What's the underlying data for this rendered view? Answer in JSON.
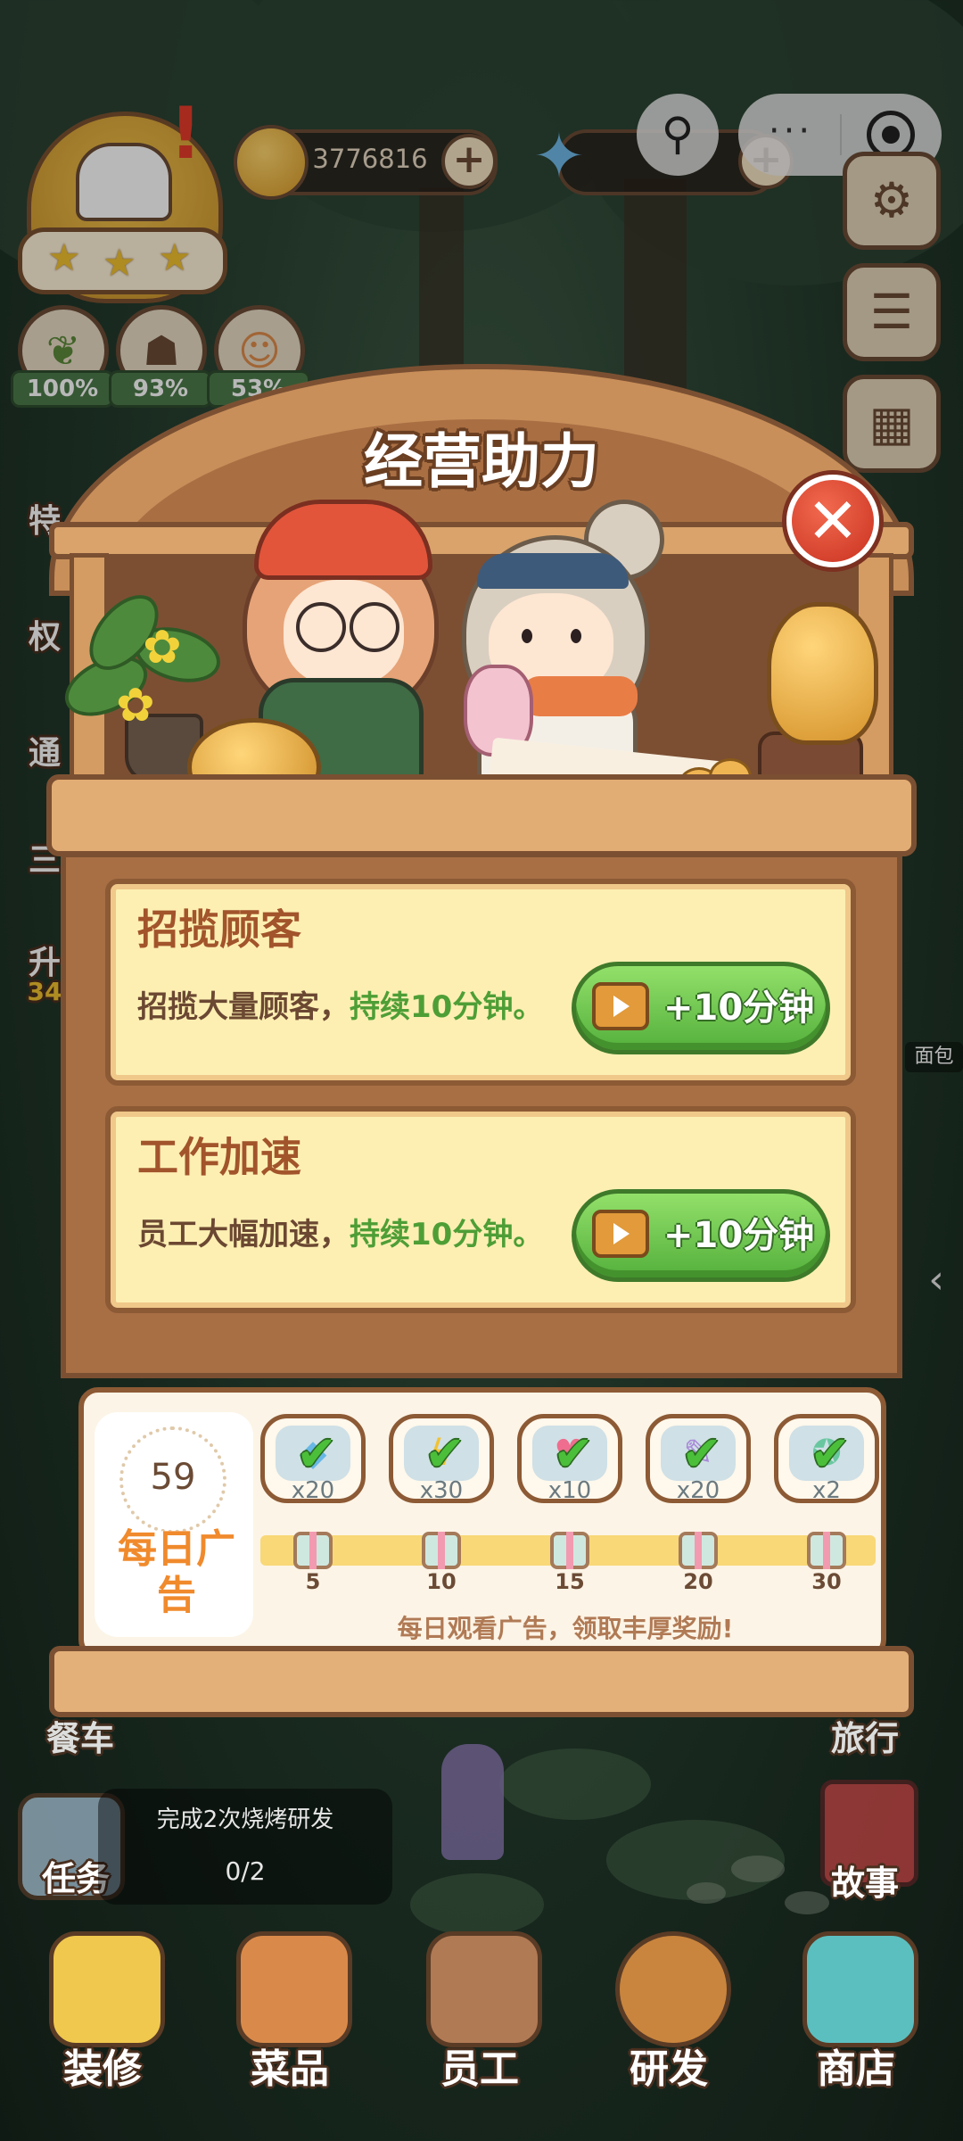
{
  "hud": {
    "coins": "3776816",
    "stats": [
      "100%",
      "93%",
      "53%"
    ],
    "plus": "+"
  },
  "mini_program": {
    "more": "···"
  },
  "dialog": {
    "title": "经营助力",
    "close": "✕",
    "cards": [
      {
        "title": "招揽顾客",
        "desc_main": "招揽大量顾客，",
        "desc_highlight": "持续10分钟。",
        "button": "+10分钟"
      },
      {
        "title": "工作加速",
        "desc_main": "员工大幅加速，",
        "desc_highlight": "持续10分钟。",
        "button": "+10分钟"
      }
    ],
    "daily_ads": {
      "count": "59",
      "label": "每日广告",
      "hint": "每日观看广告，领取丰厚奖励!",
      "rewards": [
        {
          "qty": "x20",
          "milestone": "5",
          "icon": "diamond-icon",
          "claimed": true
        },
        {
          "qty": "x30",
          "milestone": "10",
          "icon": "lightning-icon",
          "claimed": true
        },
        {
          "qty": "x10",
          "milestone": "15",
          "icon": "heart-icon",
          "claimed": true
        },
        {
          "qty": "x20",
          "milestone": "20",
          "icon": "feather-icon",
          "claimed": true
        },
        {
          "qty": "x2",
          "milestone": "30",
          "icon": "star-ticket-icon",
          "claimed": true
        }
      ],
      "check": "✔"
    }
  },
  "side_labels": {
    "left_partial": [
      "特",
      "权",
      "通",
      "三",
      "升"
    ],
    "left_number": "34",
    "canteen": "餐车",
    "travel": "旅行",
    "story": "故事",
    "mission": "任务",
    "bread_partial": "面包"
  },
  "task": {
    "text": "完成2次烧烤研发",
    "progress": "0/2"
  },
  "bottom_nav": [
    "装修",
    "菜品",
    "员工",
    "研发",
    "商店"
  ],
  "colors": {
    "accent_green": "#54b03c",
    "highlight_text": "#4e9e36",
    "card_bg": "#fdefb2",
    "wood": "#a86f45",
    "close_red": "#c9311f"
  }
}
